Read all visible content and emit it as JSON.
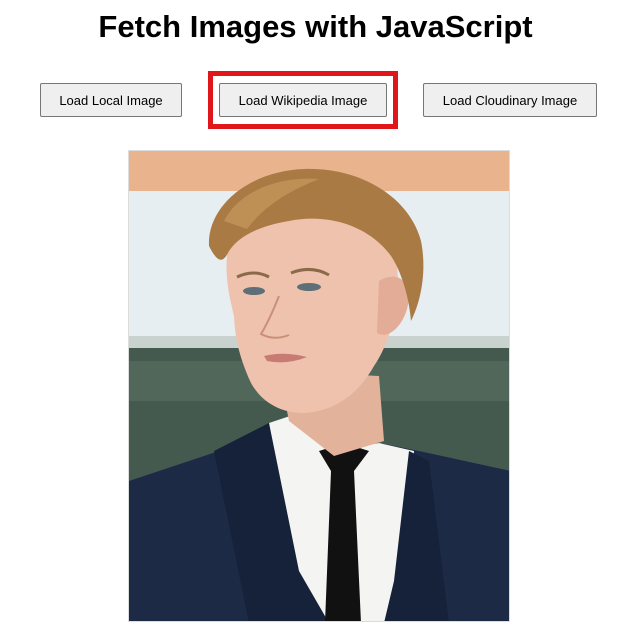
{
  "page": {
    "title": "Fetch Images with JavaScript"
  },
  "buttons": {
    "local": "Load Local Image",
    "wikipedia": "Load Wikipedia Image",
    "cloudinary": "Load Cloudinary Image"
  },
  "highlight": {
    "target": "Load Wikipedia Image",
    "color": "#e0161b"
  },
  "image": {
    "subject": "portrait photo of a man in a dark suit and black tie"
  }
}
